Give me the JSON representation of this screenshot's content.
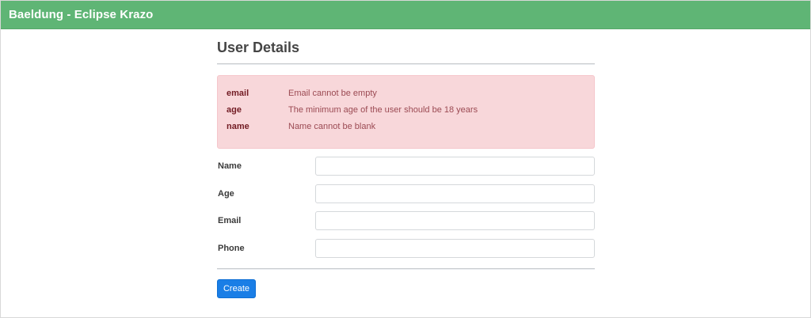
{
  "navbar": {
    "brand": "Baeldung - Eclipse Krazo"
  },
  "page": {
    "title": "User Details"
  },
  "errors": [
    {
      "field": "email",
      "message": "Email cannot be empty"
    },
    {
      "field": "age",
      "message": "The minimum age of the user should be 18 years"
    },
    {
      "field": "name",
      "message": "Name cannot be blank"
    }
  ],
  "form": {
    "fields": [
      {
        "label": "Name",
        "value": ""
      },
      {
        "label": "Age",
        "value": ""
      },
      {
        "label": "Email",
        "value": ""
      },
      {
        "label": "Phone",
        "value": ""
      }
    ],
    "submit_label": "Create"
  },
  "colors": {
    "navbar": "#5fb575",
    "alert_background": "#f8d7da",
    "alert_text": "#721c24",
    "button": "#1a7ee6"
  }
}
